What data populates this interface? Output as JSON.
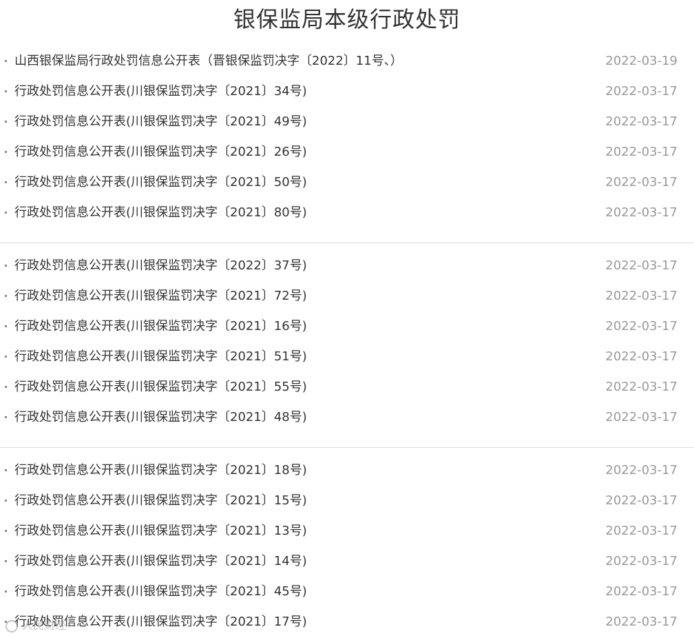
{
  "page": {
    "title": "银保监局本级行政处罚"
  },
  "groups": [
    {
      "items": [
        {
          "title": "山西银保监局行政处罚信息公开表（晋银保监罚决字〔2022〕11号、）",
          "date": "2022-03-19"
        },
        {
          "title": "行政处罚信息公开表(川银保监罚决字〔2021〕34号)",
          "date": "2022-03-17"
        },
        {
          "title": "行政处罚信息公开表(川银保监罚决字〔2021〕49号)",
          "date": "2022-03-17"
        },
        {
          "title": "行政处罚信息公开表(川银保监罚决字〔2021〕26号)",
          "date": "2022-03-17"
        },
        {
          "title": "行政处罚信息公开表(川银保监罚决字〔2021〕50号)",
          "date": "2022-03-17"
        },
        {
          "title": "行政处罚信息公开表(川银保监罚决字〔2021〕80号)",
          "date": "2022-03-17"
        }
      ]
    },
    {
      "items": [
        {
          "title": "行政处罚信息公开表(川银保监罚决字〔2022〕37号)",
          "date": "2022-03-17"
        },
        {
          "title": "行政处罚信息公开表(川银保监罚决字〔2021〕72号)",
          "date": "2022-03-17"
        },
        {
          "title": "行政处罚信息公开表(川银保监罚决字〔2021〕16号)",
          "date": "2022-03-17"
        },
        {
          "title": "行政处罚信息公开表(川银保监罚决字〔2021〕51号)",
          "date": "2022-03-17"
        },
        {
          "title": "行政处罚信息公开表(川银保监罚决字〔2021〕55号)",
          "date": "2022-03-17"
        },
        {
          "title": "行政处罚信息公开表(川银保监罚决字〔2021〕48号)",
          "date": "2022-03-17"
        }
      ]
    },
    {
      "items": [
        {
          "title": "行政处罚信息公开表(川银保监罚决字〔2021〕18号)",
          "date": "2022-03-17"
        },
        {
          "title": "行政处罚信息公开表(川银保监罚决字〔2021〕15号)",
          "date": "2022-03-17"
        },
        {
          "title": "行政处罚信息公开表(川银保监罚决字〔2021〕13号)",
          "date": "2022-03-17"
        },
        {
          "title": "行政处罚信息公开表(川银保监罚决字〔2021〕14号)",
          "date": "2022-03-17"
        },
        {
          "title": "行政处罚信息公开表(川银保监罚决字〔2021〕45号)",
          "date": "2022-03-17"
        },
        {
          "title": "行政处罚信息公开表(川银保监罚决字〔2021〕17号)",
          "date": "2022-03-17"
        }
      ]
    }
  ],
  "watermark": {
    "text": "人民财经",
    "icon": "circle-logo-icon"
  }
}
